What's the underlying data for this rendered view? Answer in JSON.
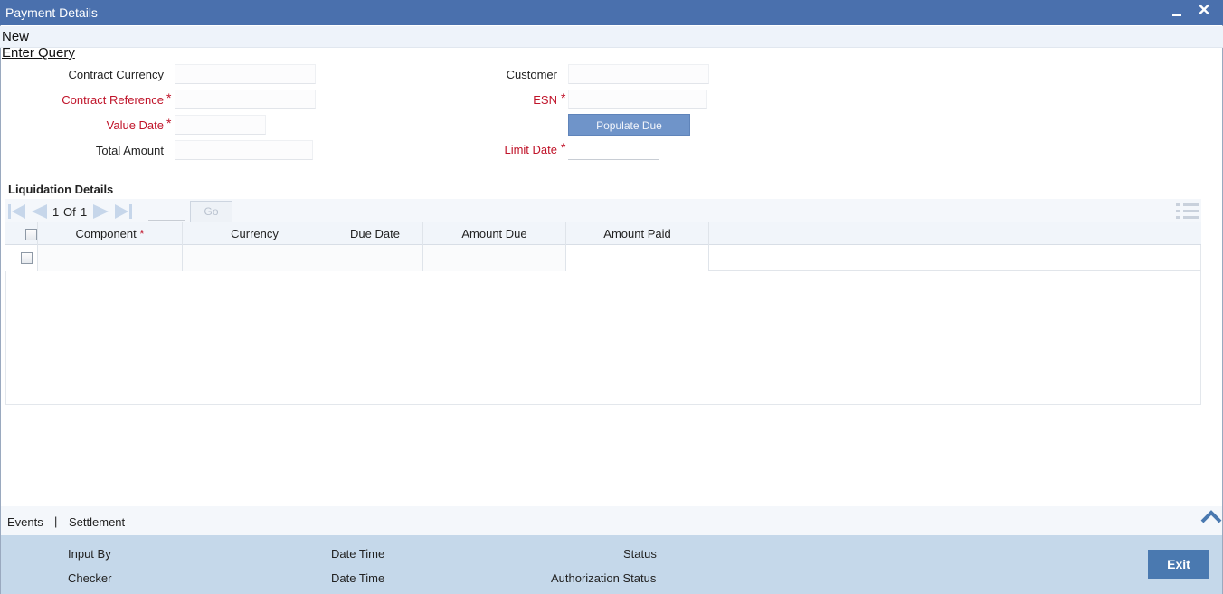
{
  "window": {
    "title": "Payment Details"
  },
  "menu": {
    "new": "New",
    "enter_query": "Enter Query"
  },
  "form": {
    "contract_currency": {
      "label": "Contract Currency",
      "value": ""
    },
    "contract_reference": {
      "label": "Contract Reference",
      "value": ""
    },
    "value_date": {
      "label": "Value Date",
      "value": ""
    },
    "total_amount": {
      "label": "Total Amount",
      "value": ""
    },
    "customer": {
      "label": "Customer",
      "value": ""
    },
    "esn": {
      "label": "ESN",
      "value": ""
    },
    "populate_due": "Populate Due",
    "limit_date": {
      "label": "Limit Date",
      "value": ""
    },
    "required_marker": "*"
  },
  "liquidation": {
    "title": "Liquidation Details",
    "pager": {
      "current": "1",
      "of": "Of",
      "total": "1",
      "go": "Go",
      "page_value": ""
    },
    "columns": [
      "Component",
      "Currency",
      "Due Date",
      "Amount Due",
      "Amount Paid"
    ],
    "rows": [
      {
        "component": "",
        "currency": "",
        "due_date": "",
        "amount_due": "",
        "amount_paid": ""
      }
    ]
  },
  "links": {
    "events": "Events",
    "separator": "|",
    "settlement": "Settlement"
  },
  "footer": {
    "input_by": "Input By",
    "date_time_1": "Date Time",
    "status": "Status",
    "checker": "Checker",
    "date_time_2": "Date Time",
    "authorization_status": "Authorization Status",
    "exit": "Exit"
  },
  "colors": {
    "titlebar": "#4a70ad",
    "required": "#c0142a",
    "footer": "#c5d8ea",
    "button": "#4a79b0"
  }
}
